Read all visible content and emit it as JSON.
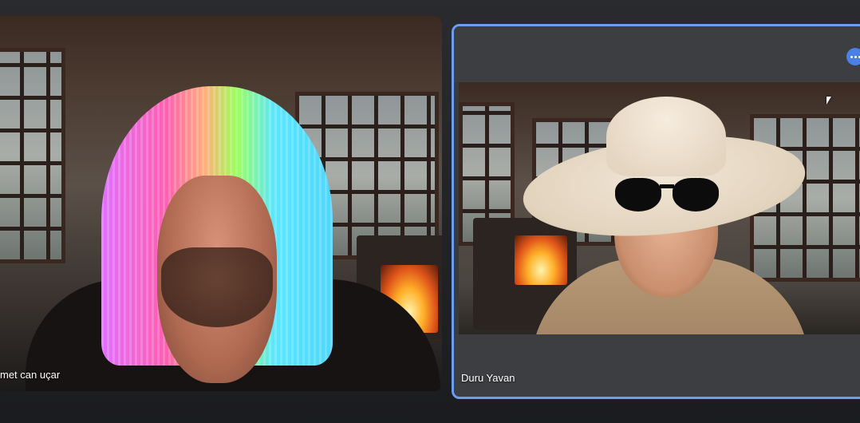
{
  "participants": [
    {
      "name": "met can uçar",
      "highlighted": false
    },
    {
      "name": "Duru Yavan",
      "highlighted": true
    }
  ],
  "controls": {
    "more_options_icon": "more-horizontal-icon"
  },
  "colors": {
    "active_border": "#6b9ef0",
    "more_button": "#4a80e8",
    "background": "#1e1f22"
  }
}
